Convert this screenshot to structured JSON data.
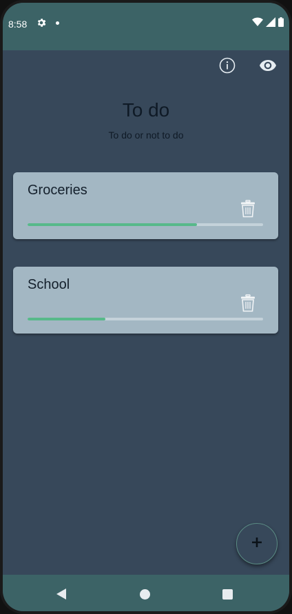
{
  "status_bar": {
    "time": "8:58",
    "icons": [
      "gear-icon",
      "notification-dot-icon",
      "wifi-icon",
      "cell-signal-icon",
      "battery-icon"
    ]
  },
  "app_bar": {
    "icons": [
      "info-icon",
      "eye-icon"
    ]
  },
  "header": {
    "title": "To do",
    "subtitle": "To do or not to do"
  },
  "lists": [
    {
      "name": "Groceries",
      "progress": 0.72
    },
    {
      "name": "School",
      "progress": 0.33
    }
  ],
  "fab": {
    "icon": "plus-icon"
  },
  "nav_bar": {
    "icons": [
      "back-icon",
      "home-icon",
      "recents-icon"
    ]
  },
  "colors": {
    "background": "#37485a",
    "system_bar": "#3c6366",
    "card": "#a3b7c3",
    "progress": "#57b98a"
  }
}
